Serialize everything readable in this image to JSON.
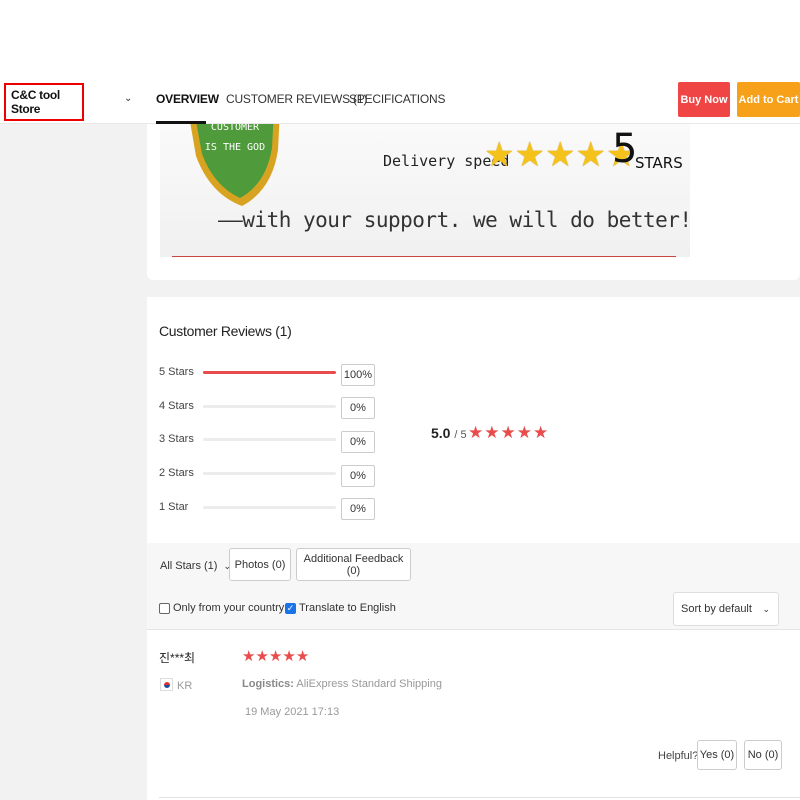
{
  "header": {
    "store_name": "C&C tool Store",
    "tabs": [
      {
        "label": "OVERVIEW",
        "active": true
      },
      {
        "label": "CUSTOMER REVIEWS (1)",
        "active": false
      },
      {
        "label": "SPECIFICATIONS",
        "active": false
      }
    ],
    "buy_now_label": "Buy Now",
    "add_to_cart_label": "Add to Cart",
    "colors": {
      "buy_now": "#f04545",
      "add_to_cart": "#f7a11a"
    }
  },
  "banner": {
    "badge_lines": [
      "CUSTOMER",
      "IS THE GOD"
    ],
    "delivery_label": "Delivery speed",
    "star_count_number": "5",
    "star_count_word": "STARS",
    "slogan": "——with your support. we will do better!——"
  },
  "reviews": {
    "title": "Customer Reviews (1)",
    "distribution": [
      {
        "label": "5 Stars",
        "percent_text": "100%",
        "fraction": 1.0
      },
      {
        "label": "4 Stars",
        "percent_text": "0%",
        "fraction": 0
      },
      {
        "label": "3 Stars",
        "percent_text": "0%",
        "fraction": 0
      },
      {
        "label": "2 Stars",
        "percent_text": "0%",
        "fraction": 0
      },
      {
        "label": "1 Star",
        "percent_text": "0%",
        "fraction": 0
      }
    ],
    "average": "5.0",
    "average_max": "/ 5",
    "average_stars": 5,
    "star_color": "#e84c4c"
  },
  "filters": {
    "all_stars": "All Stars (1)",
    "photos": "Photos (0)",
    "additional_feedback": "Additional Feedback (0)",
    "only_country": {
      "label": "Only from your country",
      "checked": false
    },
    "translate": {
      "label": "Translate to English",
      "checked": true
    },
    "sort": "Sort by default"
  },
  "review_item": {
    "reviewer": "진***최",
    "country": "KR",
    "stars": 5,
    "logistics_label": "Logistics:",
    "logistics_value": "AliExpress Standard Shipping",
    "date": "19 May 2021 17:13",
    "helpful_label": "Helpful?",
    "yes_label": "Yes (0)",
    "no_label": "No (0)"
  }
}
